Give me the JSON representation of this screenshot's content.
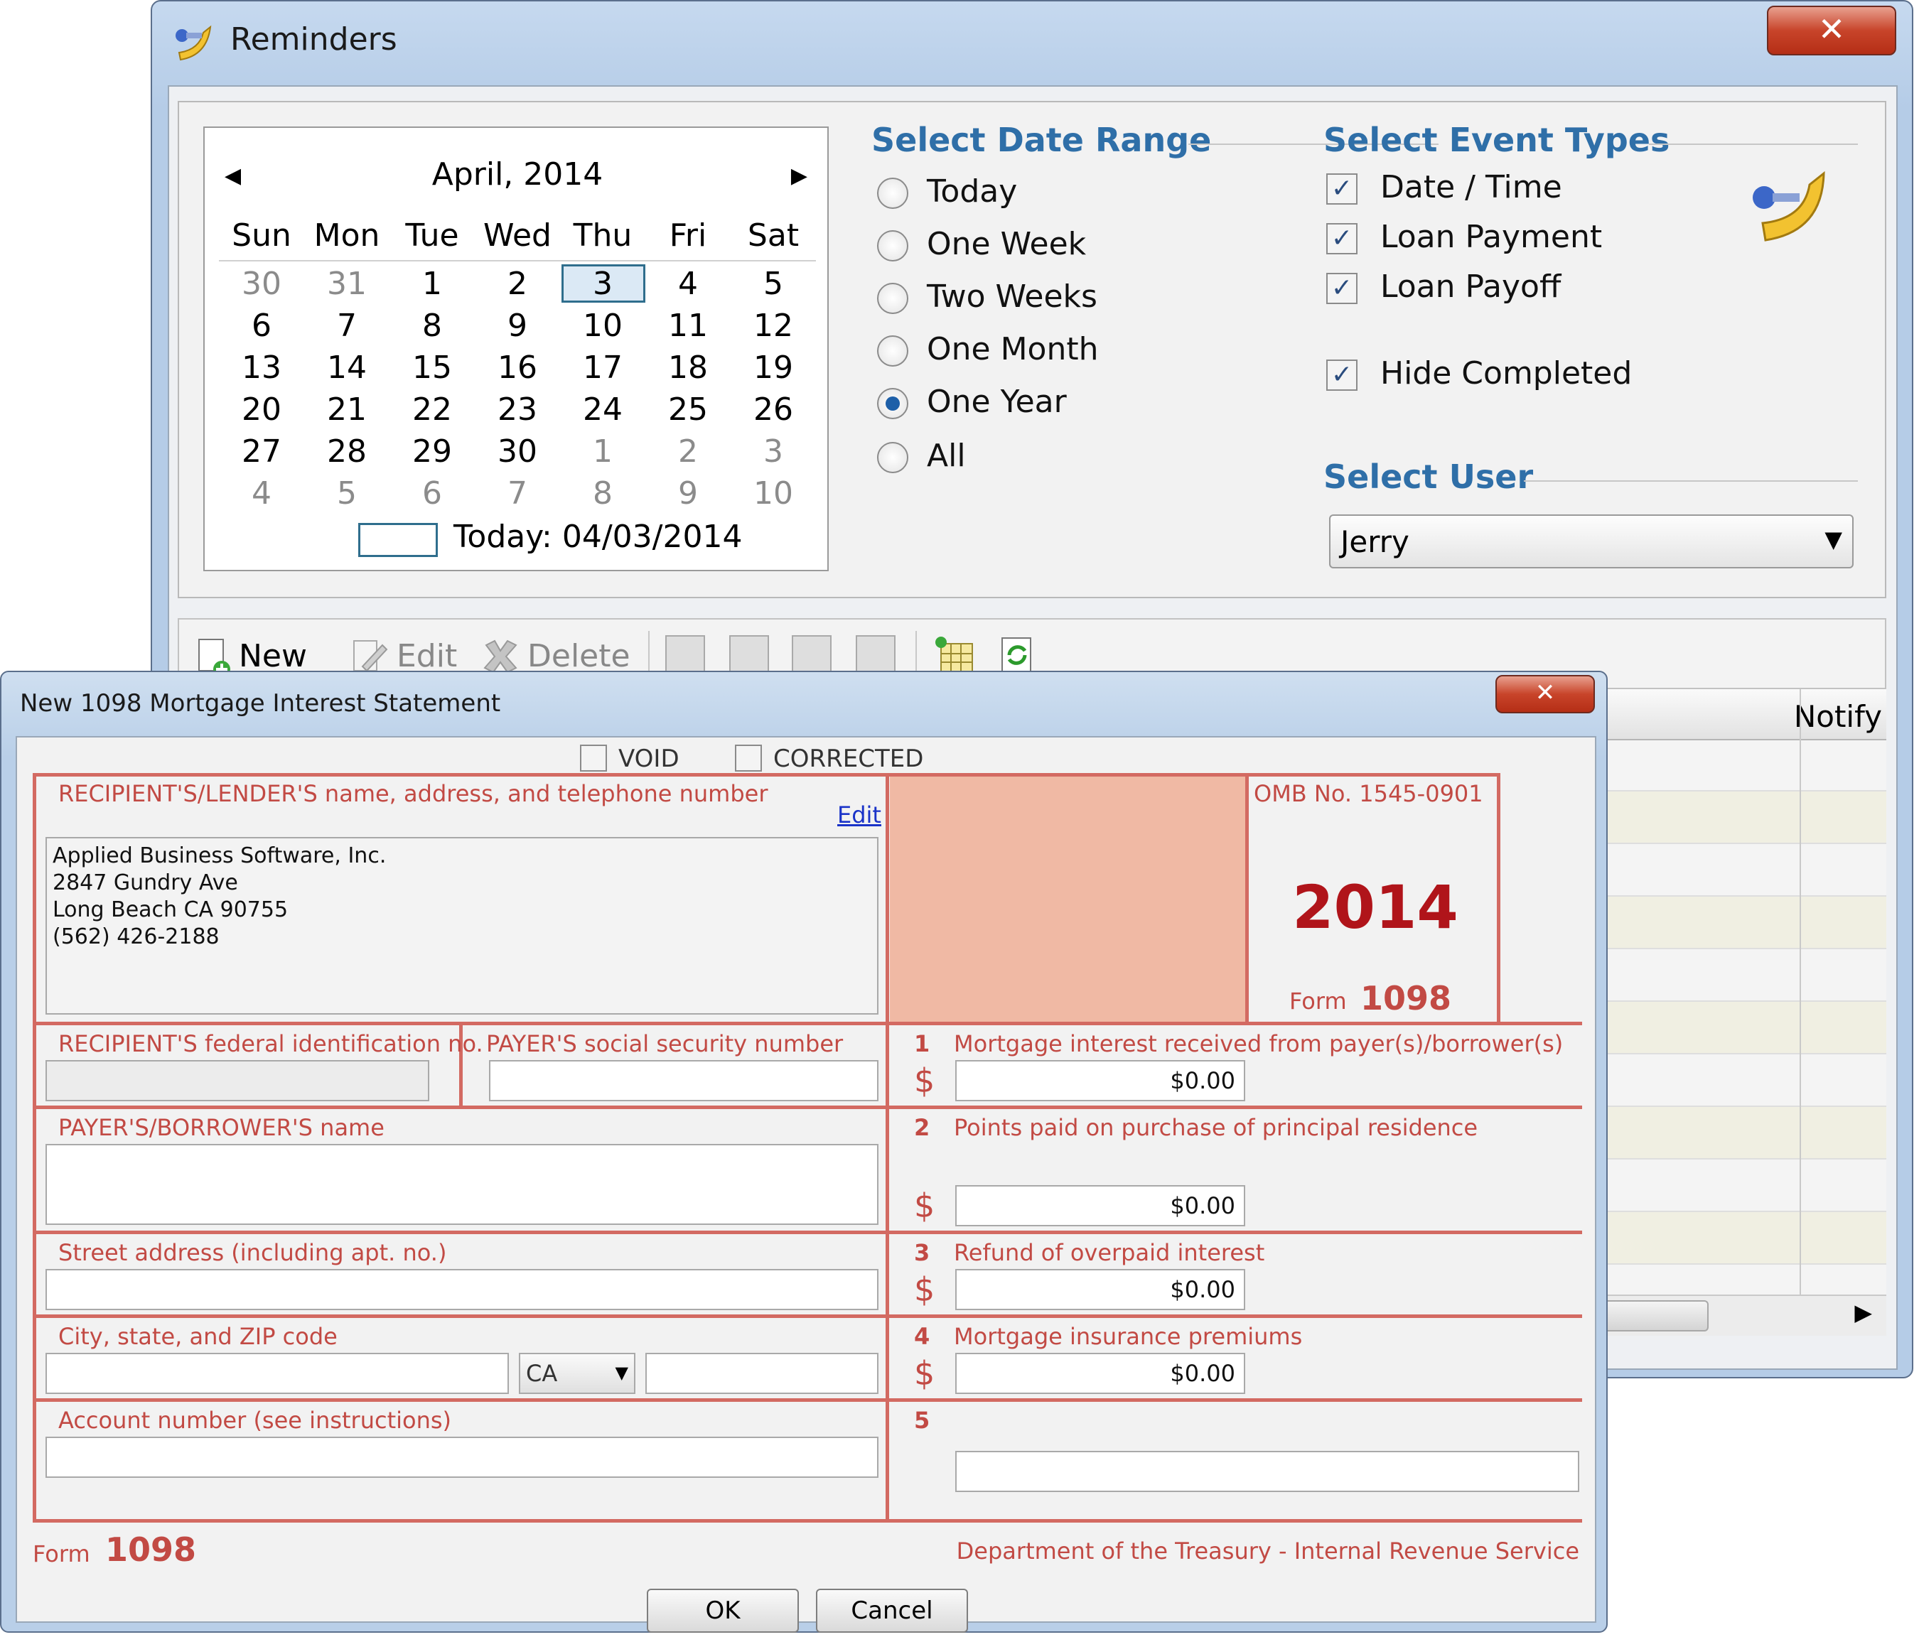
{
  "reminders": {
    "title": "Reminders",
    "close_glyph": "✕",
    "calendar": {
      "prev": "◀",
      "next": "▶",
      "month_label": "April, 2014",
      "weekdays": [
        "Sun",
        "Mon",
        "Tue",
        "Wed",
        "Thu",
        "Fri",
        "Sat"
      ],
      "weeks": [
        [
          "30",
          "31",
          "1",
          "2",
          "3",
          "4",
          "5"
        ],
        [
          "6",
          "7",
          "8",
          "9",
          "10",
          "11",
          "12"
        ],
        [
          "13",
          "14",
          "15",
          "16",
          "17",
          "18",
          "19"
        ],
        [
          "20",
          "21",
          "22",
          "23",
          "24",
          "25",
          "26"
        ],
        [
          "27",
          "28",
          "29",
          "30",
          "1",
          "2",
          "3"
        ],
        [
          "4",
          "5",
          "6",
          "7",
          "8",
          "9",
          "10"
        ]
      ],
      "selected_day": "3",
      "today_label": "Today: 04/03/2014"
    },
    "date_range": {
      "title": "Select Date Range",
      "options": [
        "Today",
        "One Week",
        "Two Weeks",
        "One Month",
        "One Year",
        "All"
      ],
      "selected": "One Year"
    },
    "event_types": {
      "title": "Select Event Types",
      "check_glyph": "✓",
      "items": [
        {
          "label": "Date / Time",
          "checked": true
        },
        {
          "label": "Loan Payment",
          "checked": true
        },
        {
          "label": "Loan Payoff",
          "checked": true
        },
        {
          "label": "Hide Completed",
          "checked": true
        }
      ]
    },
    "user": {
      "title": "Select User",
      "value": "Jerry",
      "arrow": "▼"
    },
    "toolbar": {
      "new": "New",
      "edit": "Edit",
      "delete": "Delete"
    },
    "grid": {
      "notify_header": "Notify",
      "scroll_right": "▶"
    },
    "icons": {
      "app": "pushpin-icon",
      "toolbar": [
        "new-icon",
        "edit-icon",
        "delete-icon",
        "print-icon",
        "print-preview-icon",
        "columns-icon",
        "clear-icon",
        "calendar-grid-icon",
        "refresh-icon"
      ]
    }
  },
  "form1098": {
    "title": "New 1098 Mortgage Interest Statement",
    "close_glyph": "✕",
    "void_label": "VOID",
    "corrected_label": "CORRECTED",
    "recipient_label": "RECIPIENT'S/LENDER'S name, address, and telephone number",
    "edit_link": "Edit",
    "recipient_lines": [
      "Applied Business Software, Inc.",
      "2847 Gundry Ave",
      "Long Beach CA 90755",
      "(562) 426-2188"
    ],
    "omb": "OMB No. 1545-0901",
    "year": "2014",
    "form_word": "Form",
    "form_number": "1098",
    "recipient_fed_id_label": "RECIPIENT'S federal identification no.",
    "payer_ssn_label": "PAYER'S social security number",
    "payer_name_label": "PAYER'S/BORROWER'S name",
    "street_label": "Street address (including apt. no.)",
    "city_label": "City, state, and ZIP code",
    "state_value": "CA",
    "state_arrow": "▼",
    "account_label": "Account number (see instructions)",
    "dollar": "$",
    "boxes": [
      {
        "num": "1",
        "label": "Mortgage interest received from payer(s)/borrower(s)",
        "value": "$0.00"
      },
      {
        "num": "2",
        "label": "Points paid on purchase of principal residence",
        "value": "$0.00"
      },
      {
        "num": "3",
        "label": "Refund of overpaid interest",
        "value": "$0.00"
      },
      {
        "num": "4",
        "label": "Mortgage insurance premiums",
        "value": "$0.00"
      },
      {
        "num": "5",
        "label": "",
        "value": ""
      }
    ],
    "footer_agency": "Department of the Treasury - Internal Revenue Service",
    "ok_label": "OK",
    "cancel_label": "Cancel",
    "colors": {
      "form_red": "#c24a44",
      "shade": "#f0b9a4",
      "accent": "#2f6fa8"
    }
  }
}
